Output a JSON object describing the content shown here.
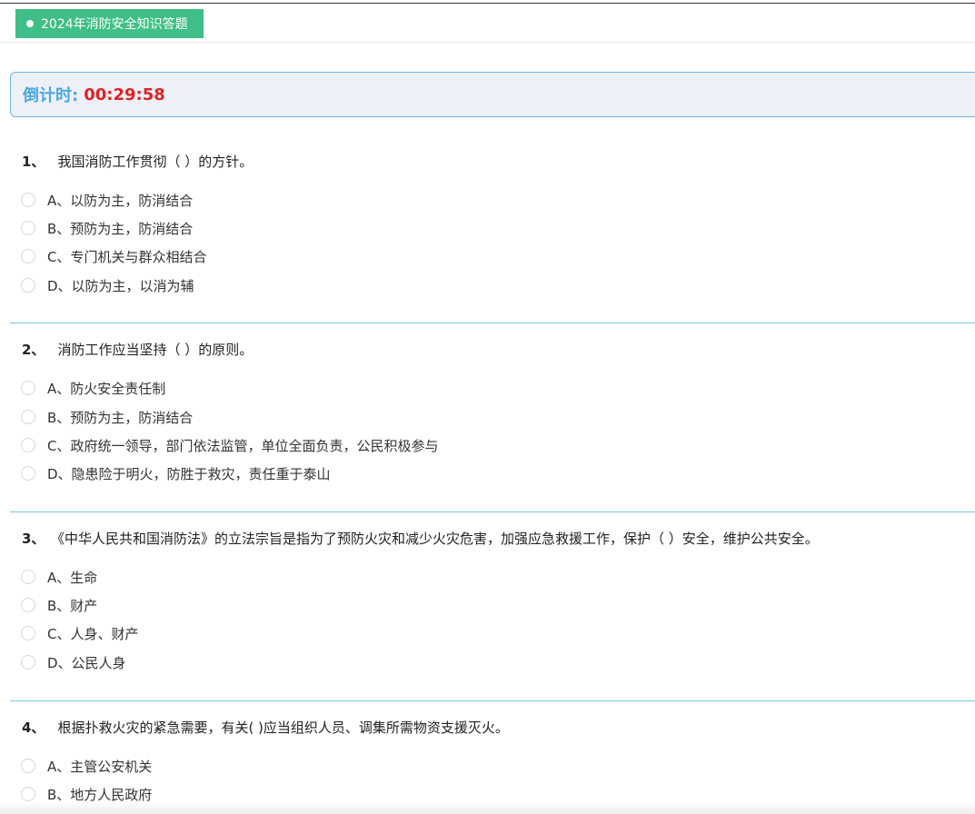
{
  "header": {
    "title": "2024年消防安全知识答题"
  },
  "countdown": {
    "label": "倒计时:",
    "value": "00:29:58"
  },
  "questions": [
    {
      "number": "1、",
      "text": "我国消防工作贯彻（ ）的方针。",
      "options": [
        "A、以防为主，防消结合",
        "B、预防为主，防消结合",
        "C、专门机关与群众相结合",
        "D、以防为主，以消为辅"
      ]
    },
    {
      "number": "2、",
      "text": "消防工作应当坚持（ ）的原则。",
      "options": [
        "A、防火安全责任制",
        "B、预防为主，防消结合",
        "C、政府统一领导，部门依法监管，单位全面负责，公民积极参与",
        "D、隐患险于明火，防胜于救灾，责任重于泰山"
      ]
    },
    {
      "number": "3、",
      "text": "《中华人民共和国消防法》的立法宗旨是指为了预防火灾和减少火灾危害，加强应急救援工作，保护（ ）安全，维护公共安全。",
      "options": [
        "A、生命",
        "B、财产",
        "C、人身、财产",
        "D、公民人身"
      ]
    },
    {
      "number": "4、",
      "text": "根据扑救火灾的紧急需要，有关( )应当组织人员、调集所需物资支援灭火。",
      "options": [
        "A、主管公安机关",
        "B、地方人民政府"
      ]
    }
  ]
}
